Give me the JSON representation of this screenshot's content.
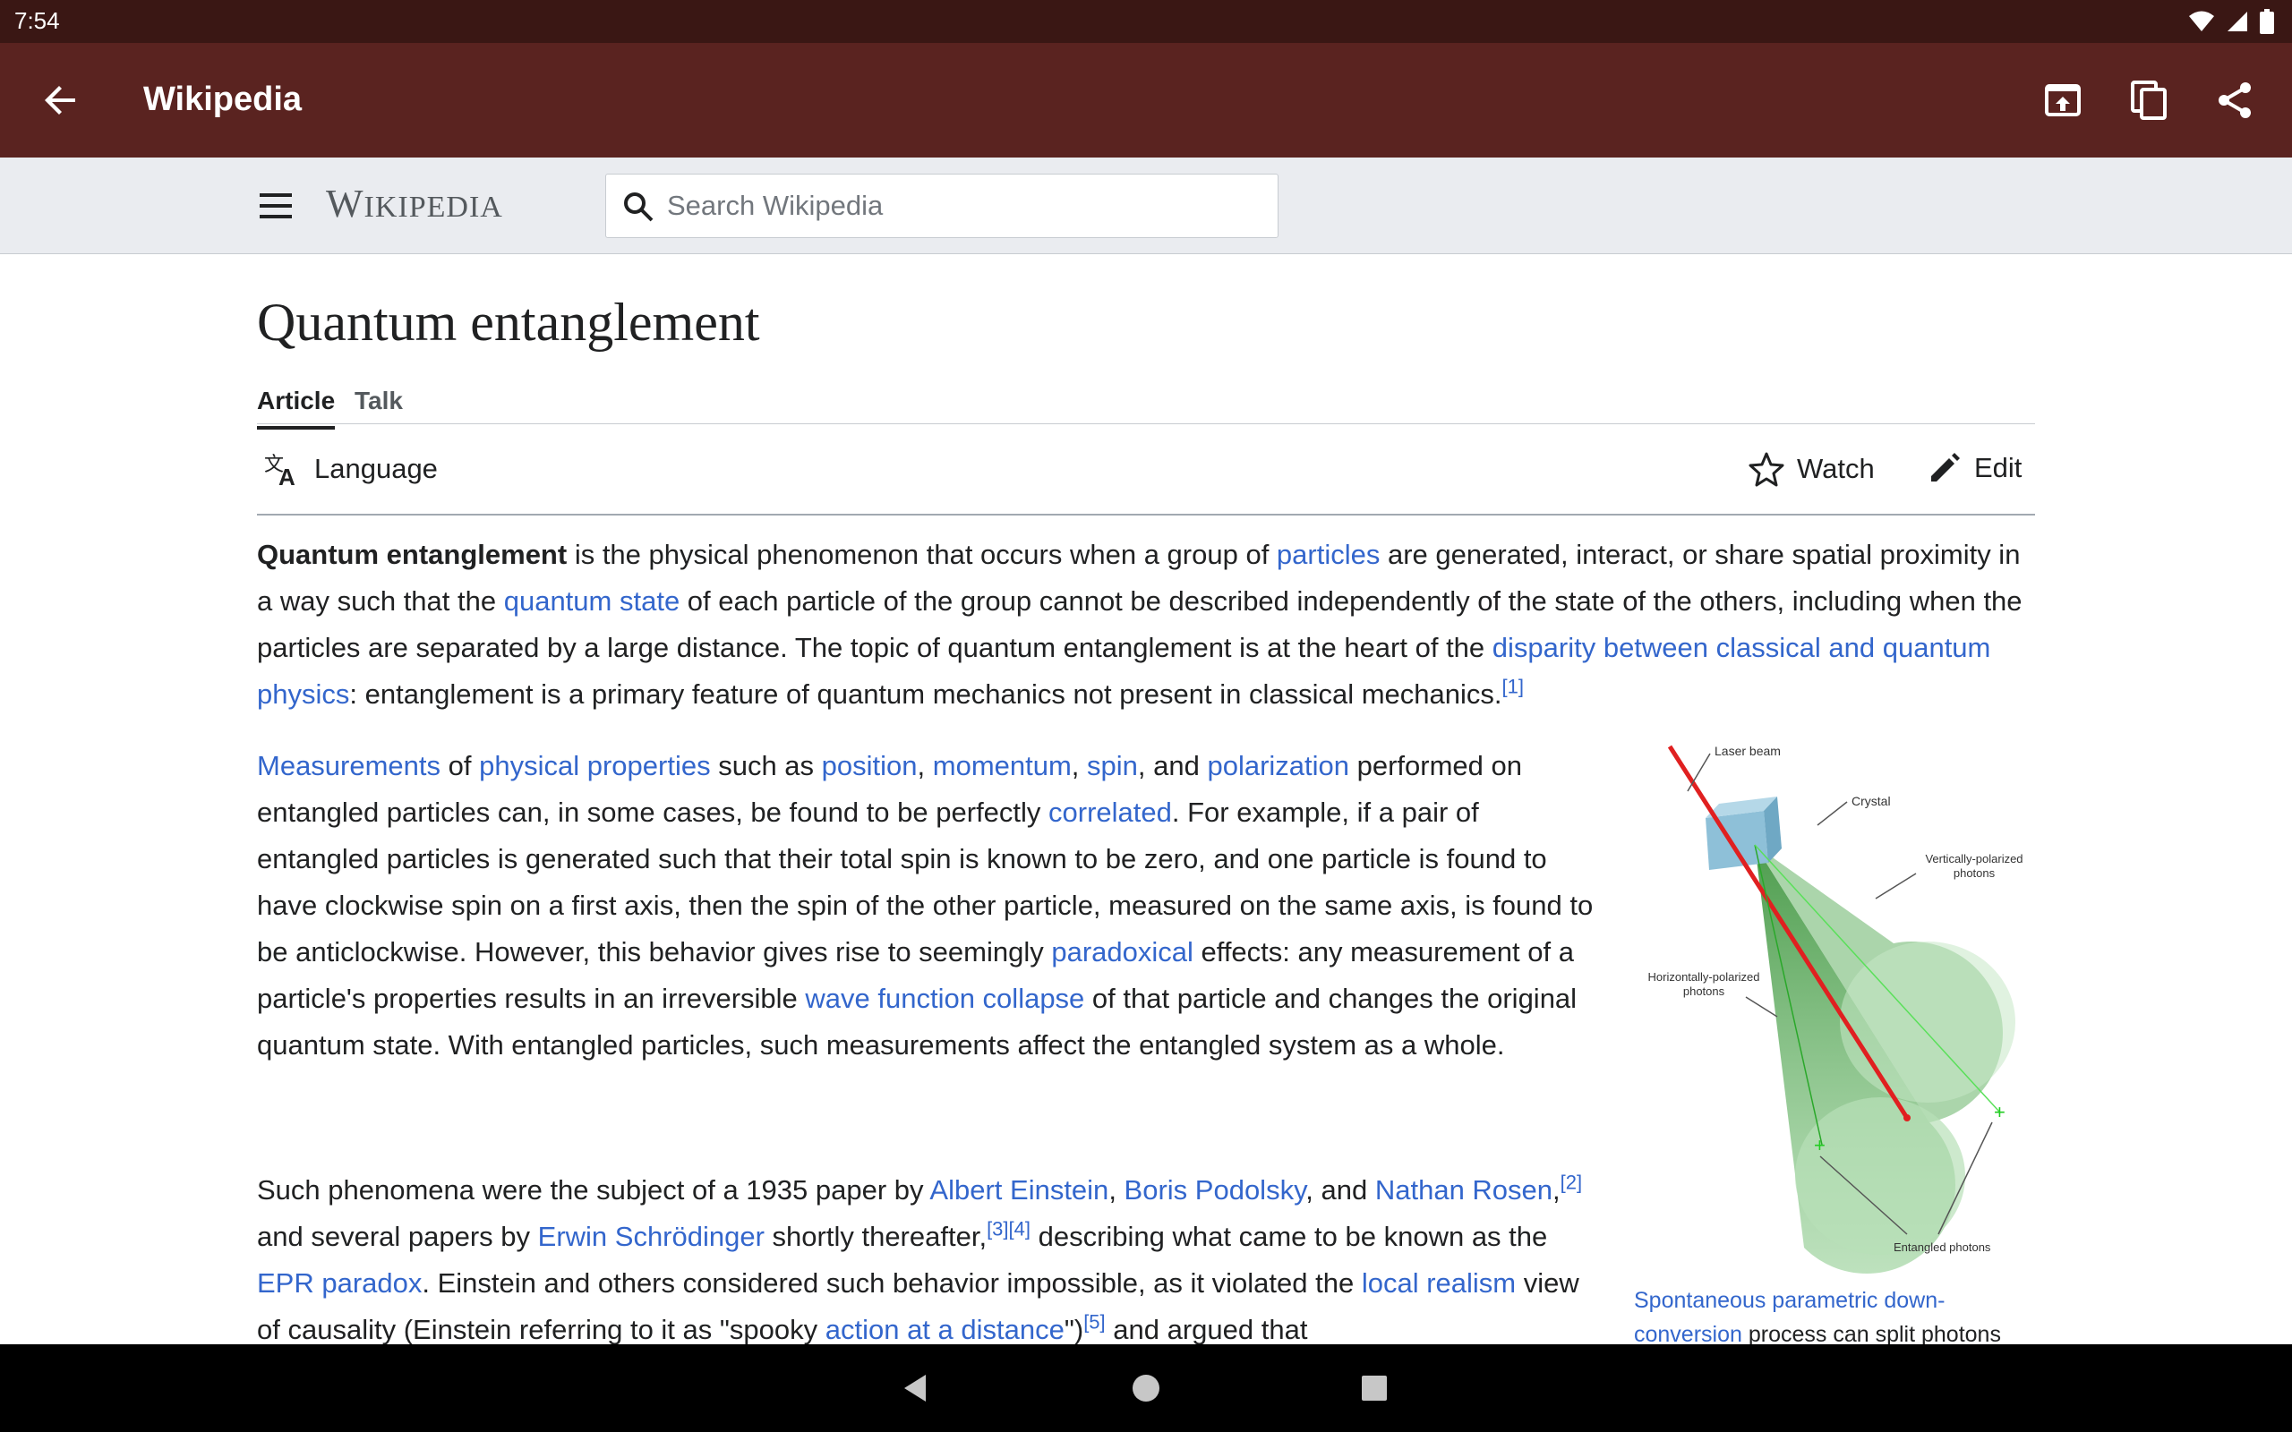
{
  "status": {
    "time": "7:54"
  },
  "appbar": {
    "title": "Wikipedia"
  },
  "header": {
    "wordmark_first": "W",
    "wordmark_rest": "IKIPEDIA",
    "search_placeholder": "Search Wikipedia"
  },
  "article": {
    "title": "Quantum entanglement",
    "tabs": [
      {
        "label": "Article"
      },
      {
        "label": "Talk"
      }
    ],
    "actions": {
      "language": "Language",
      "watch": "Watch",
      "edit": "Edit"
    },
    "p1": {
      "t1": "Quantum entanglement",
      "t2": " is the physical phenomenon that occurs when a group of ",
      "l1": "particles",
      "t3": " are generated, interact, or share spatial proximity in a way such that the ",
      "l2": "quantum state",
      "t4": " of each particle of the group cannot be described independently of the state of the others, including when the particles are separated by a large distance. The topic of quantum entanglement is at the heart of the ",
      "l3": "disparity between classical and quantum physics",
      "t5": ": entanglement is a primary feature of quantum mechanics not present in classical mechanics.",
      "r1": "[1]"
    },
    "p2": {
      "l1": "Measurements",
      "t1": " of ",
      "l2": "physical properties",
      "t2": " such as ",
      "l3": "position",
      "t3": ", ",
      "l4": "momentum",
      "t4": ", ",
      "l5": "spin",
      "t5": ", and ",
      "l6": "polarization",
      "t6": " performed on entangled particles can, in some cases, be found to be perfectly ",
      "l7": "correlated",
      "t7": ". For example, if a pair of entangled particles is generated such that their total spin is known to be zero, and one particle is found to have clockwise spin on a first axis, then the spin of the other particle, measured on the same axis, is found to be anticlockwise. However, this behavior gives rise to seemingly ",
      "l8": "paradoxical",
      "t8": " effects: any measurement of a particle's properties results in an irreversible ",
      "l9": "wave function collapse",
      "t9": " of that particle and changes the original quantum state. With entangled particles, such measurements affect the entangled system as a whole."
    },
    "p3": {
      "t1": "Such phenomena were the subject of a 1935 paper by ",
      "l1": "Albert Einstein",
      "t2": ", ",
      "l2": "Boris Podolsky",
      "t3": ", and ",
      "l3": "Nathan Rosen",
      "t4": ",",
      "r1": "[2]",
      "t5": " and several papers by ",
      "l4": "Erwin Schrödinger",
      "t6": " shortly thereafter,",
      "r2": "[3]",
      "r3": "[4]",
      "t7": " describing what came to be known as the ",
      "l5": "EPR paradox",
      "t8": ". Einstein and others considered such behavior impossible, as it violated the ",
      "l6": "local realism",
      "t9": " view of causality (Einstein referring to it as \"spooky ",
      "l7": "action at a distance",
      "t10": "\")",
      "r4": "[5]",
      "t11": " and argued that"
    },
    "figure": {
      "labels": {
        "laser": "Laser beam",
        "crystal": "Crystal",
        "vert1": "Vertically-polarized",
        "vert2": "photons",
        "horiz1": "Horizontally-polarized",
        "horiz2": "photons",
        "entangled": "Entangled photons"
      },
      "caption_link": "Spontaneous parametric down-conversion",
      "caption_text": " process can split photons"
    }
  }
}
